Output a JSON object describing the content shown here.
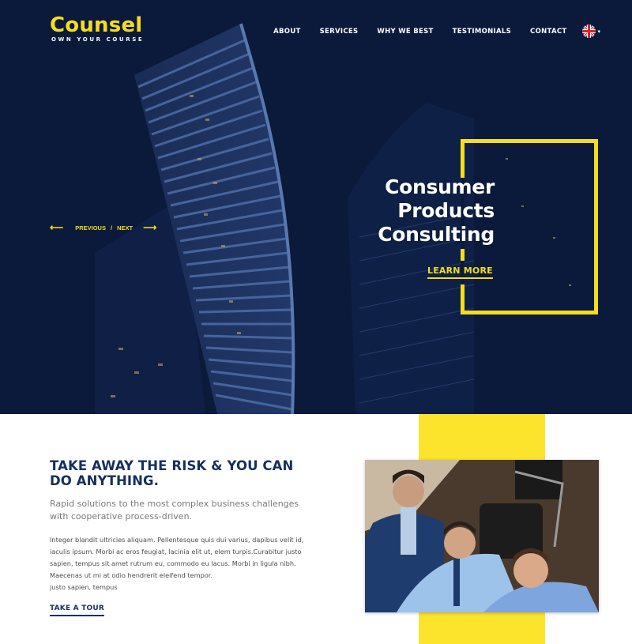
{
  "brand": {
    "name": "Counsel",
    "tagline": "OWN YOUR COURSE"
  },
  "nav": {
    "items": [
      {
        "label": "ABOUT"
      },
      {
        "label": "SERVICES"
      },
      {
        "label": "WHY WE BEST"
      },
      {
        "label": "TESTIMONIALS"
      },
      {
        "label": "CONTACT"
      }
    ],
    "language": {
      "icon": "uk-flag-icon",
      "caret": "▾"
    }
  },
  "hero": {
    "title_lines": [
      "Consumer",
      "Products",
      "Consulting"
    ],
    "cta": "LEARN MORE",
    "slider": {
      "prev_arrow": "⟵",
      "prev_label": "PREVIOUS",
      "separator": "/",
      "next_label": "NEXT",
      "next_arrow": "⟶"
    }
  },
  "intro": {
    "heading": "TAKE AWAY THE RISK & YOU CAN DO ANYTHING.",
    "lead": "Rapid solutions to the most complex business challenges with cooperative process-driven.",
    "body": "Integer blandit ultricies aliquam. Pellentesque quis dui varius, dapibus velit id, iaculis ipsum. Morbi ac eros feugiat, lacinia elit ut, elem turpis.Curabitur justo sapien, tempus sit amet rutrum eu, commodo eu lacus. Morbi in ligula nibh. Maecenas ut mi at odio hendrerit eleifend tempor.",
    "body_extra": "justo sapien, tempus",
    "cta": "TAKE A TOUR"
  },
  "colors": {
    "navy": "#0b1a3a",
    "accent_yellow": "#f5dd1f",
    "band_yellow": "#fde42c",
    "heading_blue": "#15305f"
  }
}
